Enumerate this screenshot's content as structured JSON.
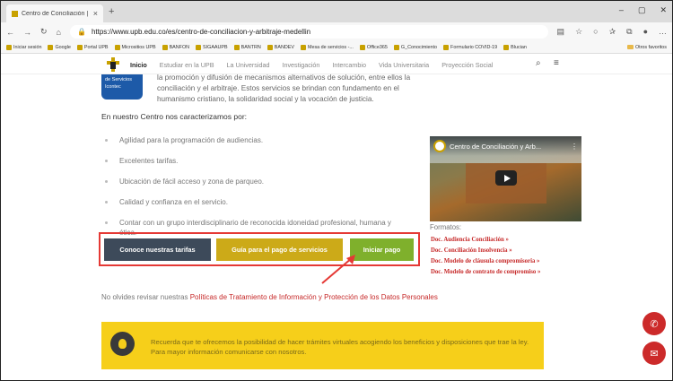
{
  "browser": {
    "tab_title": "Centro de Conciliación | UPB",
    "tab_close": "×",
    "new_tab": "+",
    "url": "https://www.upb.edu.co/es/centro-de-conciliacion-y-arbitraje-medellin",
    "bookmarks": [
      "Iniciar sesión",
      "Google",
      "Portal UPB",
      "Micrositios UPB",
      "BANFON",
      "SIGAAUPB",
      "BANTRN",
      "BANDEV",
      "Mesa de servicios -...",
      "Office365",
      "G_Conocimiento",
      "Formulario COVID-19",
      "Blucian"
    ],
    "bookmarks_folder": "Otros favoritos"
  },
  "nav": {
    "items": [
      "Inicio",
      "Estudiar en la UPB",
      "La Universidad",
      "Investigación",
      "Intercambio",
      "Vida Universitaria",
      "Proyección Social"
    ]
  },
  "badge": {
    "line1": "de Servicios",
    "line2": "Icontec"
  },
  "intro": "la promoción y difusión de mecanismos alternativos de solución, entre ellos la conciliación y el arbitraje. Estos servicios se brindan con fundamento en el humanismo cristiano, la solidaridad social y la vocación de justicia.",
  "heading": "En nuestro Centro nos caracterizamos por:",
  "features": [
    "Agilidad para la programación de audiencias.",
    "Excelentes tarifas.",
    "Ubicación de fácil acceso y zona de parqueo.",
    "Calidad y confianza en el servicio.",
    "Contar con un grupo interdisciplinario de reconocida idoneidad profesional, humana y ética."
  ],
  "video": {
    "title": "Centro de Conciliación y Arb...",
    "menu": "⋮"
  },
  "formatos": {
    "label": "Formatos:",
    "links": [
      "Doc. Audiencia Conciliación »",
      "Doc. Conciliación Insolvencia »",
      "Doc. Modelo de cláusula compromisoria »",
      "Doc. Modelo de contrato de compromiso »"
    ]
  },
  "buttons": {
    "tarifas": "Conoce nuestras tarifas",
    "guia": "Guía para el pago de servicios",
    "iniciar": "Iniciar pago"
  },
  "privacy": {
    "prefix": "No olvides revisar nuestras",
    "link": "Políticas de Tratamiento de Información y Protección de los Datos Personales"
  },
  "notice": "Recuerda que te ofrecemos la posibilidad de hacer trámites virtuales acogiendo los beneficios y disposiciones que trae la ley. Para mayor información comunicarse con nosotros.",
  "colors": {
    "accent_red": "#c62828",
    "yellow": "#f6cf1a",
    "green": "#7fb02c",
    "slate": "#3d4a5a",
    "gold": "#ccaa18"
  }
}
